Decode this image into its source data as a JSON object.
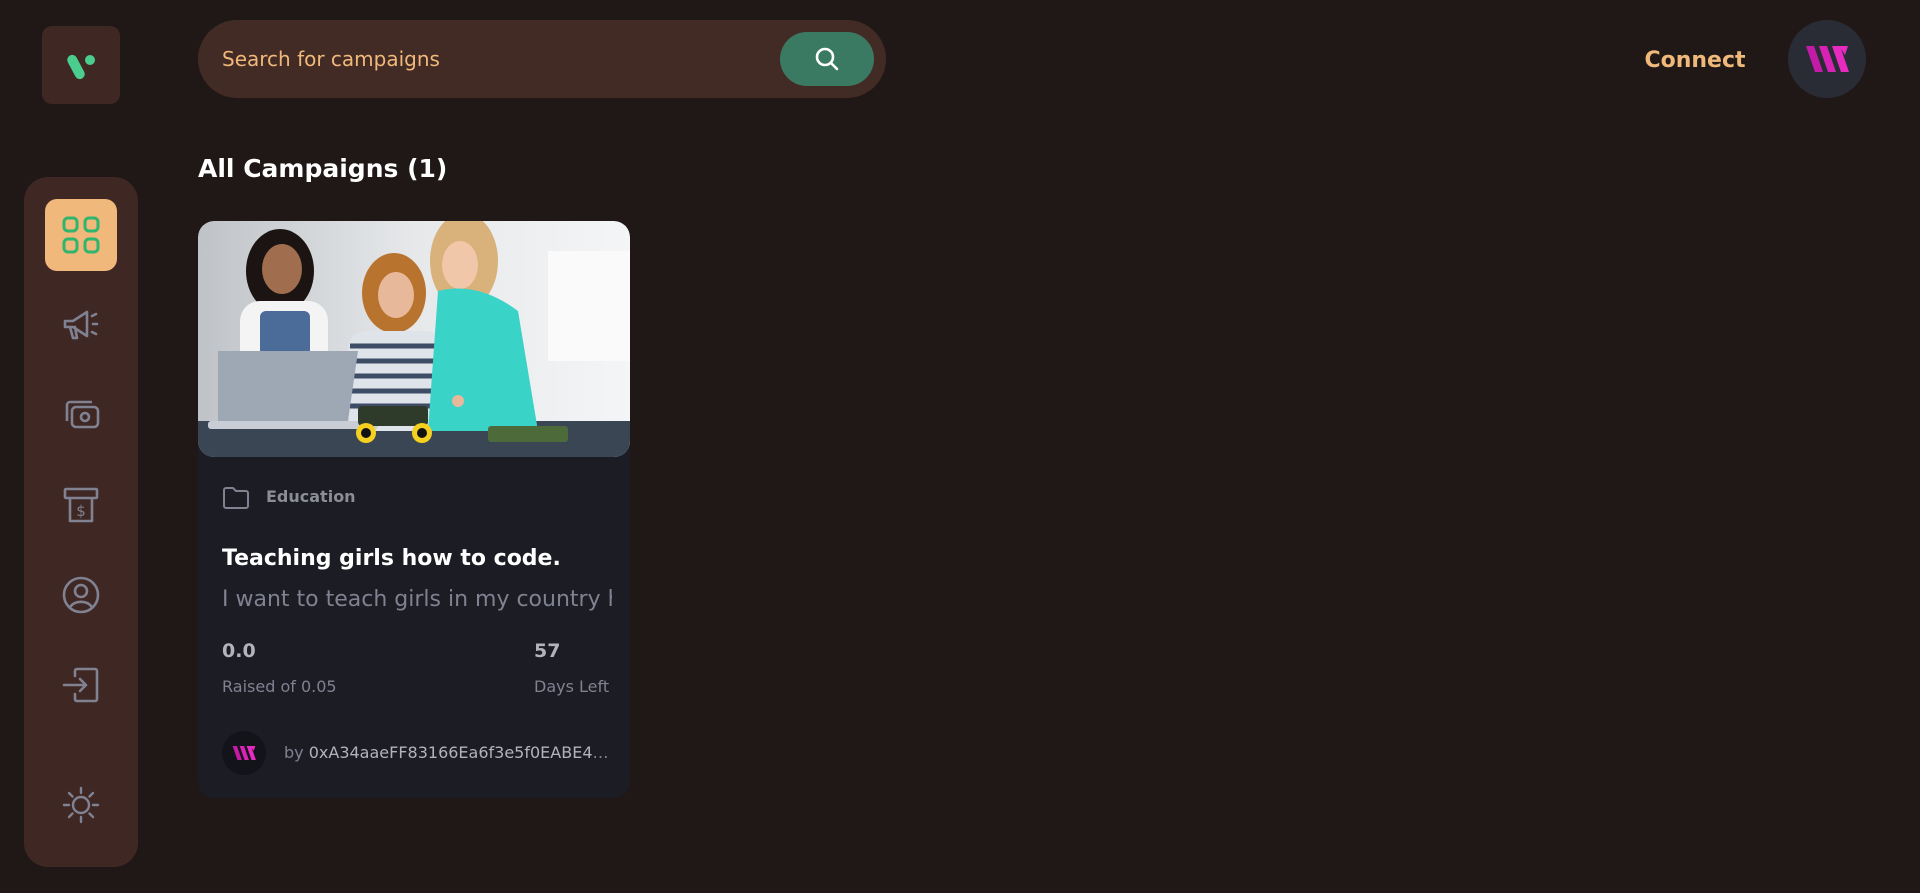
{
  "header": {
    "search": {
      "placeholder": "Search for campaigns",
      "value": ""
    },
    "connect_label": "Connect"
  },
  "sidebar": {
    "items": [
      {
        "icon": "dashboard-icon",
        "active": true
      },
      {
        "icon": "megaphone-icon",
        "active": false
      },
      {
        "icon": "payment-icon",
        "active": false
      },
      {
        "icon": "withdraw-icon",
        "active": false
      },
      {
        "icon": "profile-icon",
        "active": false
      },
      {
        "icon": "logout-icon",
        "active": false
      }
    ],
    "theme_icon": "sun-icon"
  },
  "main": {
    "title": "All Campaigns (1)",
    "campaigns": [
      {
        "category": "Education",
        "title": "Teaching girls how to code.",
        "description": "I want to teach girls in my country how to code and build robots.",
        "raised": "0.0",
        "raised_label": "Raised of 0.05",
        "days_left": "57",
        "days_left_label": "Days Left",
        "by_label": "by",
        "owner": "0xA34aaeFF83166Ea6f3e5f0EABE4a..."
      }
    ]
  },
  "colors": {
    "background": "#1f1816",
    "panel": "#3f2824",
    "accent": "#f0b87a",
    "search_button": "#3a7a62",
    "brand_green": "#4acd8d",
    "card": "#1c1c24"
  }
}
